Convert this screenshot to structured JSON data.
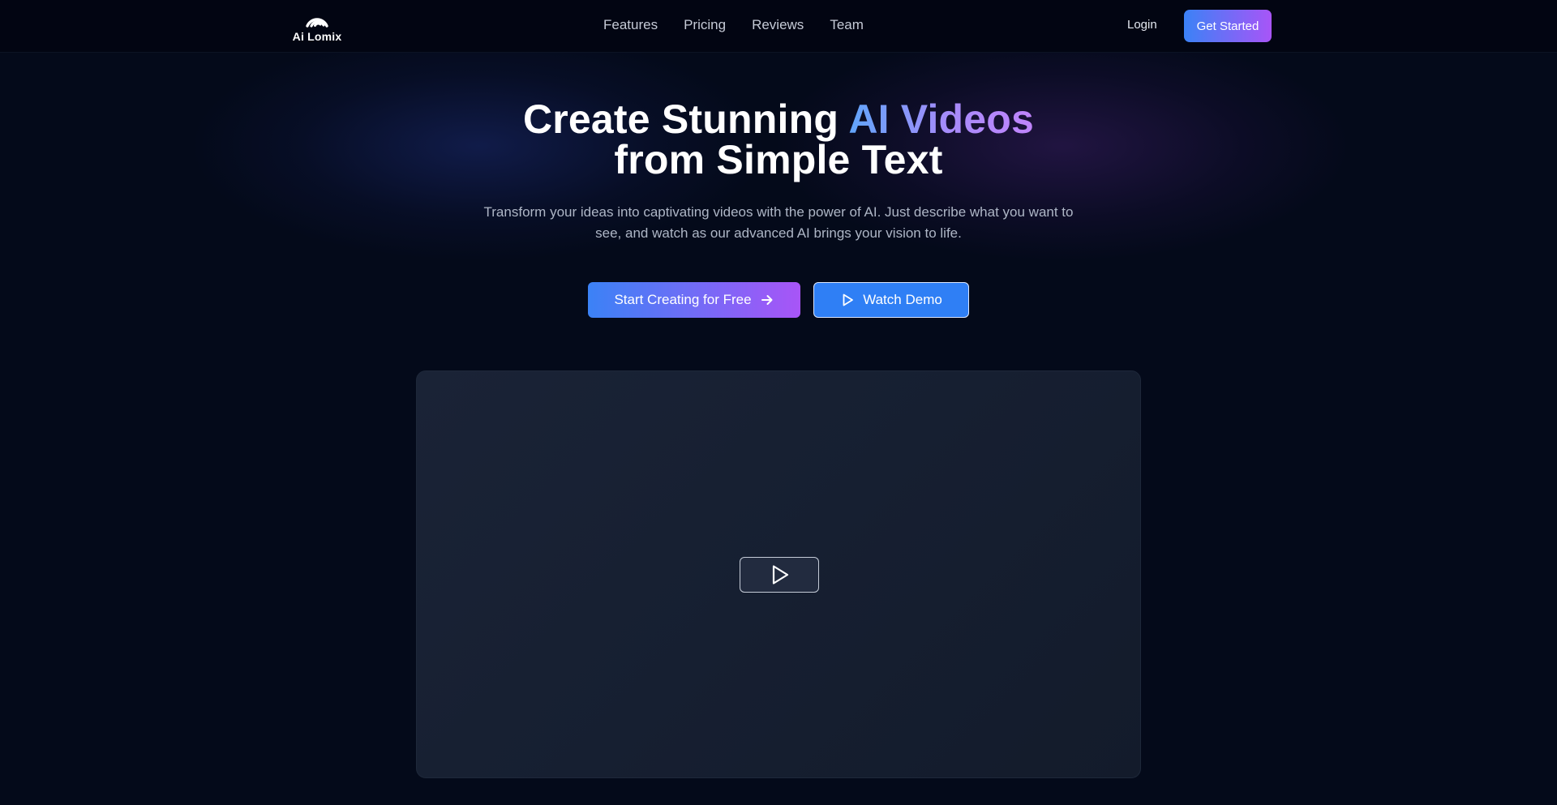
{
  "brand": {
    "name": "Ai Lomix",
    "logo_icon": "logo-arcs-icon"
  },
  "nav": {
    "links": [
      "Features",
      "Pricing",
      "Reviews",
      "Team"
    ],
    "login_label": "Login",
    "get_started_label": "Get Started"
  },
  "hero": {
    "title_part1": "Create Stunning ",
    "title_highlight": "AI Videos",
    "title_line2": "from Simple Text",
    "subtitle": "Transform your ideas into captivating videos with the power of AI. Just describe what you want to see, and watch as our advanced AI brings your vision to life.",
    "primary_cta": "Start Creating for Free",
    "primary_cta_icon": "arrow-right-icon",
    "secondary_cta": "Watch Demo",
    "secondary_cta_icon": "play-icon"
  },
  "video": {
    "play_icon": "play-icon"
  },
  "colors": {
    "background": "#040a1a",
    "accent_blue": "#3b82f6",
    "accent_purple": "#a855f7"
  }
}
